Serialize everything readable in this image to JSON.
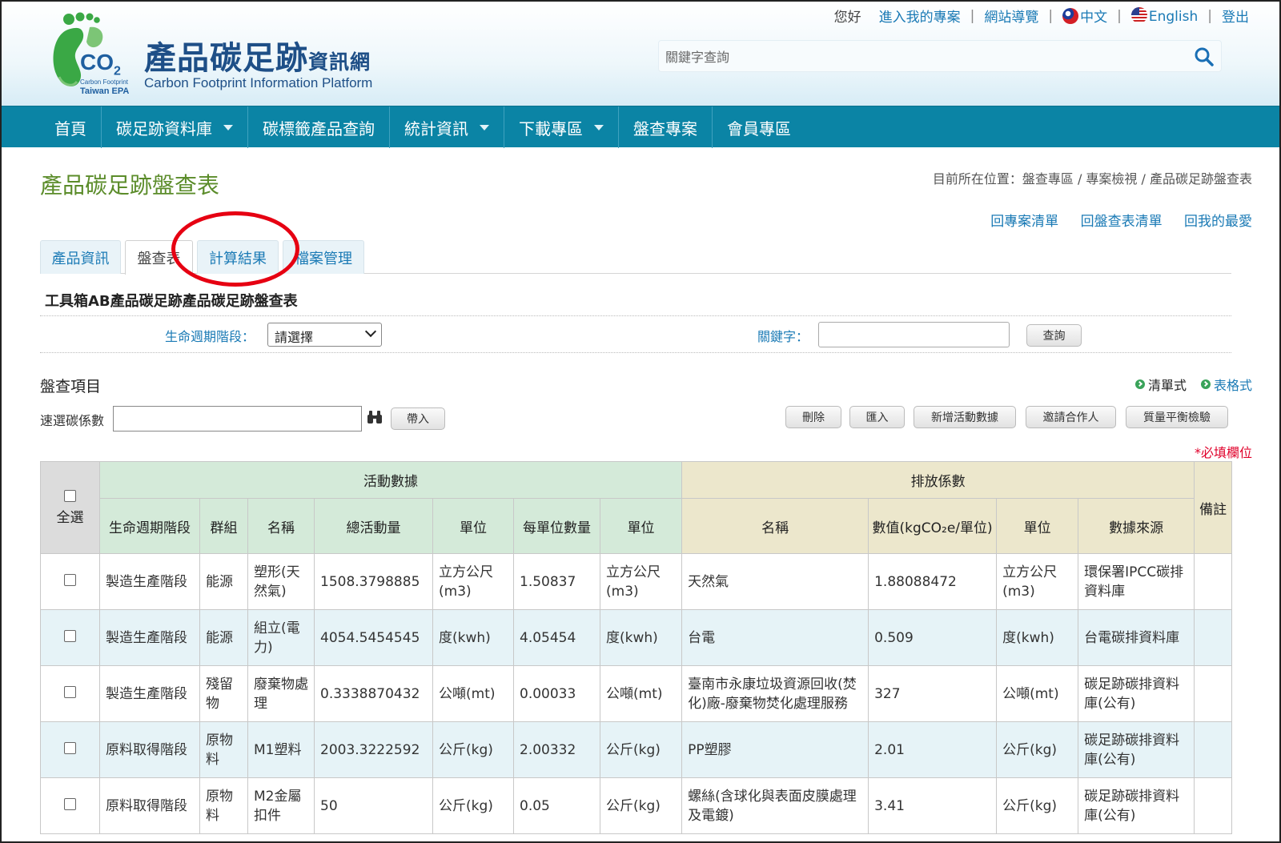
{
  "site": {
    "title_main": "產品碳足跡",
    "title_small": "資訊網",
    "subtitle": "Carbon Footprint Information Platform",
    "logo_co2": "CO",
    "logo_co2_sub": "2",
    "logo_epa_line1": "Carbon Footprint",
    "logo_epa_line2": "Taiwan EPA"
  },
  "toplinks": {
    "greeting": "您好",
    "items": [
      "進入我的專案",
      "網站導覽",
      "中文",
      "English",
      "登出"
    ]
  },
  "search": {
    "placeholder": "關鍵字查詢"
  },
  "nav": {
    "items": [
      {
        "label": "首頁"
      },
      {
        "label": "碳足跡資料庫"
      },
      {
        "label": "碳標籤產品查詢"
      },
      {
        "label": "統計資訊"
      },
      {
        "label": "下載專區"
      },
      {
        "label": "盤查專案"
      },
      {
        "label": "會員專區"
      }
    ]
  },
  "page": {
    "title": "產品碳足跡盤查表",
    "breadcrumb": "目前所在位置：盤查專區 / 專案檢視 / 產品碳足跡盤查表",
    "quicklinks": [
      "回專案清單",
      "回盤查表清單",
      "回我的最愛"
    ]
  },
  "tabs": [
    "產品資訊",
    "盤查表",
    "計算結果",
    "檔案管理"
  ],
  "form": {
    "title": "工具箱AB產品碳足跡產品碳足跡盤查表",
    "stage_label": "生命週期階段：",
    "stage_value": "請選擇",
    "keyword_label": "關鍵字：",
    "query_button": "查詢"
  },
  "inventory": {
    "title": "盤查項目",
    "view_list": "清單式",
    "view_table": "表格式",
    "fast_label": "速選碳係數",
    "import_button": "帶入",
    "actions": [
      "刪除",
      "匯入",
      "新增活動數據",
      "邀請合作人",
      "質量平衡檢驗"
    ],
    "required_note": "*必填欄位"
  },
  "table": {
    "select_all": "全選",
    "group_activity": "活動數據",
    "group_emission": "排放係數",
    "note": "備註",
    "headers": [
      "生命週期階段",
      "群組",
      "名稱",
      "總活動量",
      "單位",
      "每單位數量",
      "單位",
      "名稱",
      "數值(kgCO₂e/單位)",
      "單位",
      "數據來源"
    ],
    "rows": [
      [
        "製造生產階段",
        "能源",
        "塑形(天然氣)",
        "1508.3798885",
        "立方公尺(m3)",
        "1.50837",
        "立方公尺(m3)",
        "天然氣",
        "1.88088472",
        "立方公尺(m3)",
        "環保署IPCC碳排資料庫"
      ],
      [
        "製造生產階段",
        "能源",
        "組立(電力)",
        "4054.5454545",
        "度(kwh)",
        "4.05454",
        "度(kwh)",
        "台電",
        "0.509",
        "度(kwh)",
        "台電碳排資料庫"
      ],
      [
        "製造生產階段",
        "殘留物",
        "廢棄物處理",
        "0.3338870432",
        "公噸(mt)",
        "0.00033",
        "公噸(mt)",
        "臺南市永康垃圾資源回收(焚化)廠-廢棄物焚化處理服務",
        "327",
        "公噸(mt)",
        "碳足跡碳排資料庫(公有)"
      ],
      [
        "原料取得階段",
        "原物料",
        "M1塑料",
        "2003.3222592",
        "公斤(kg)",
        "2.00332",
        "公斤(kg)",
        "PP塑膠",
        "2.01",
        "公斤(kg)",
        "碳足跡碳排資料庫(公有)"
      ],
      [
        "原料取得階段",
        "原物料",
        "M2金屬扣件",
        "50",
        "公斤(kg)",
        "0.05",
        "公斤(kg)",
        "螺絲(含球化與表面皮膜處理及電鍍)",
        "3.41",
        "公斤(kg)",
        "碳足跡碳排資料庫(公有)"
      ]
    ]
  }
}
